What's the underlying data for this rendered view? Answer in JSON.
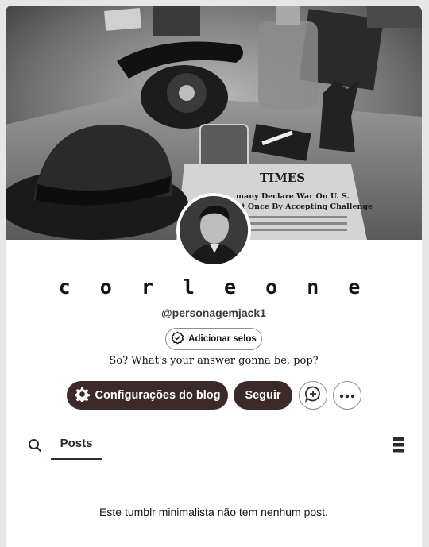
{
  "blog": {
    "title": "c o r l e o n e",
    "handle": "@personagemjack1",
    "description": "So? What's your answer gonna be, pop?"
  },
  "badges": {
    "add_label": "Adicionar selos",
    "icon": "badge-icon"
  },
  "actions": {
    "settings_label": "Configurações do blog",
    "settings_icon": "gear-icon",
    "follow_label": "Seguir",
    "message_icon": "chat-plus-icon",
    "more_icon": "more-icon"
  },
  "tabs": {
    "posts_label": "Posts",
    "search_icon": "search-icon",
    "layout_icon": "layout-icon"
  },
  "empty_state": "Este tumblr minimalista não tem nenhum post.",
  "colors": {
    "accent": "#3b2a28",
    "background": "#e6e6e6",
    "card": "#ffffff",
    "text": "#141414"
  }
}
